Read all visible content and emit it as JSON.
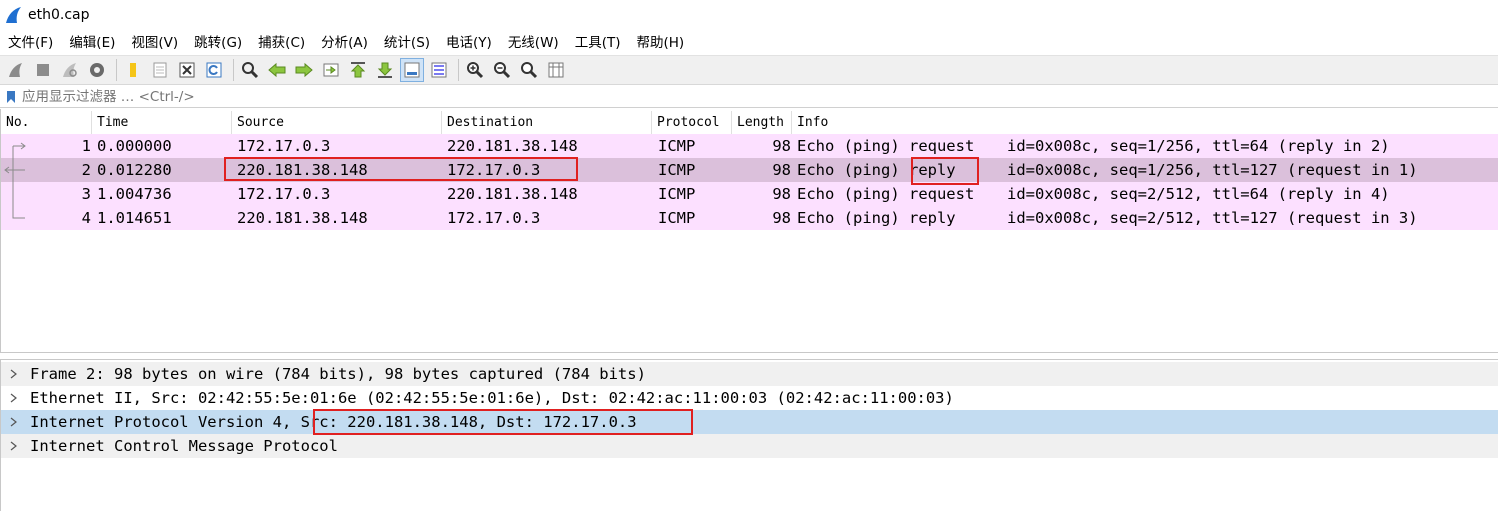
{
  "window": {
    "title": "eth0.cap"
  },
  "menu": [
    "文件(F)",
    "编辑(E)",
    "视图(V)",
    "跳转(G)",
    "捕获(C)",
    "分析(A)",
    "统计(S)",
    "电话(Y)",
    "无线(W)",
    "工具(T)",
    "帮助(H)"
  ],
  "toolbar": {
    "icons": [
      "shark-fin-start-icon",
      "stop-square-icon",
      "restart-shark-icon",
      "gear-options-icon",
      "open-folder-icon",
      "file-icon",
      "close-file-icon",
      "reload-icon",
      "search-magnifier-icon",
      "arrow-left-icon",
      "arrow-right-icon",
      "go-to-packet-icon",
      "go-first-icon",
      "go-last-icon",
      "autoscroll-icon",
      "colorize-icon",
      "zoom-in-icon",
      "zoom-out-icon",
      "zoom-normal-icon",
      "resize-columns-icon"
    ]
  },
  "filter": {
    "placeholder": "应用显示过滤器 … <Ctrl-/>"
  },
  "columns": {
    "no": "No.",
    "time": "Time",
    "source": "Source",
    "destination": "Destination",
    "protocol": "Protocol",
    "length": "Length",
    "info": "Info"
  },
  "packets": [
    {
      "no": "1",
      "time": "0.000000",
      "source": "172.17.0.3",
      "destination": "220.181.38.148",
      "protocol": "ICMP",
      "length": "98",
      "info_a": "Echo (ping) request",
      "info_b": "id=0x008c, seq=1/256, ttl=64 (reply in 2)"
    },
    {
      "no": "2",
      "time": "0.012280",
      "source": "220.181.38.148",
      "destination": "172.17.0.3",
      "protocol": "ICMP",
      "length": "98",
      "info_a": "Echo (ping) reply",
      "info_b": "id=0x008c, seq=1/256, ttl=127 (request in 1)"
    },
    {
      "no": "3",
      "time": "1.004736",
      "source": "172.17.0.3",
      "destination": "220.181.38.148",
      "protocol": "ICMP",
      "length": "98",
      "info_a": "Echo (ping) request",
      "info_b": "id=0x008c, seq=2/512, ttl=64 (reply in 4)"
    },
    {
      "no": "4",
      "time": "1.014651",
      "source": "220.181.38.148",
      "destination": "172.17.0.3",
      "protocol": "ICMP",
      "length": "98",
      "info_a": "Echo (ping) reply",
      "info_b": "id=0x008c, seq=2/512, ttl=127 (request in 3)"
    }
  ],
  "details": [
    "Frame 2: 98 bytes on wire (784 bits), 98 bytes captured (784 bits)",
    "Ethernet II, Src: 02:42:55:5e:01:6e (02:42:55:5e:01:6e), Dst: 02:42:ac:11:00:03 (02:42:ac:11:00:03)",
    "Internet Protocol Version 4, Src: 220.181.38.148, Dst: 172.17.0.3",
    "Internet Control Message Protocol"
  ],
  "colors": {
    "row_bg": "#fce0ff",
    "row_selected_bg": "#dbc0db",
    "detail_selected_bg": "#c3dcf1",
    "highlight_box": "#e02020"
  }
}
